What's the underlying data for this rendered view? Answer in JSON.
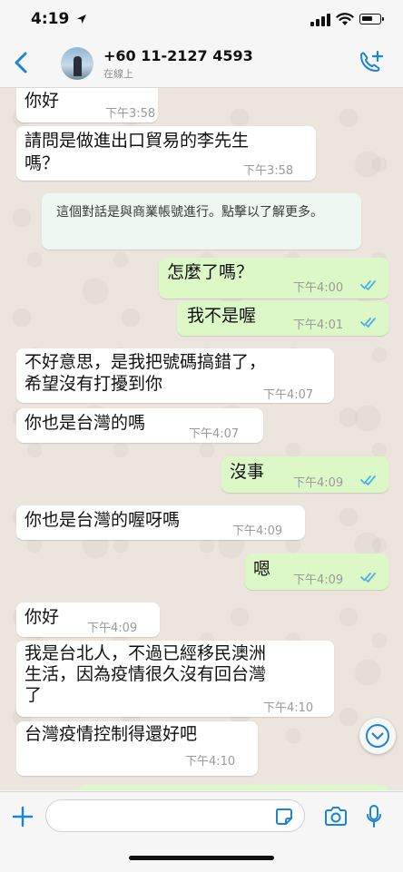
{
  "status_bar": {
    "time": "4:19",
    "location_icon": "location-arrow-icon"
  },
  "header": {
    "contact_name": "+60 11-2127 4593",
    "status": "在線上",
    "back_icon": "chevron-left-icon",
    "call_icon": "add-call-icon"
  },
  "system_notice": "這個對話是與商業帳號進行。點擊以了解更多。",
  "messages": [
    {
      "dir": "in",
      "text": "你好",
      "time": "下午3:58"
    },
    {
      "dir": "in",
      "line1": "請問是做進出口貿易的李先生",
      "line2": "嗎？",
      "time": "下午3:58"
    },
    {
      "dir": "out",
      "text": "怎麼了嗎？",
      "time": "下午4:00",
      "read": true
    },
    {
      "dir": "out",
      "text": "我不是喔",
      "time": "下午4:01",
      "read": true
    },
    {
      "dir": "in",
      "line1": "不好意思，是我把號碼搞錯了，",
      "line2": "希望沒有打擾到你",
      "time": "下午4:07"
    },
    {
      "dir": "in",
      "text": "你也是台灣的嗎",
      "time": "下午4:07"
    },
    {
      "dir": "out",
      "text": "沒事",
      "time": "下午4:09",
      "read": true
    },
    {
      "dir": "in",
      "text": "你也是台灣的喔呀嗎",
      "time": "下午4:09"
    },
    {
      "dir": "out",
      "text": "嗯",
      "time": "下午4:09",
      "read": true
    },
    {
      "dir": "in",
      "text": "你好",
      "time": "下午4:09"
    },
    {
      "dir": "in",
      "line1": "我是台北人，不過已經移民澳洲",
      "line2": "生活，因為疫情很久沒有回台灣",
      "line3": "了",
      "time": "下午4:10"
    },
    {
      "dir": "in",
      "text": "台灣疫情控制得還好吧",
      "time": "下午4:10"
    }
  ],
  "composer": {
    "placeholder": "",
    "icons": [
      "plus-icon",
      "sticker-icon",
      "camera-icon",
      "microphone-icon"
    ]
  },
  "colors": {
    "accent": "#1a84d8",
    "outgoing_bubble": "#dcf8c6",
    "incoming_bubble": "#ffffff",
    "chat_bg": "#ece5dd",
    "read_ticks": "#4fb0e8"
  }
}
